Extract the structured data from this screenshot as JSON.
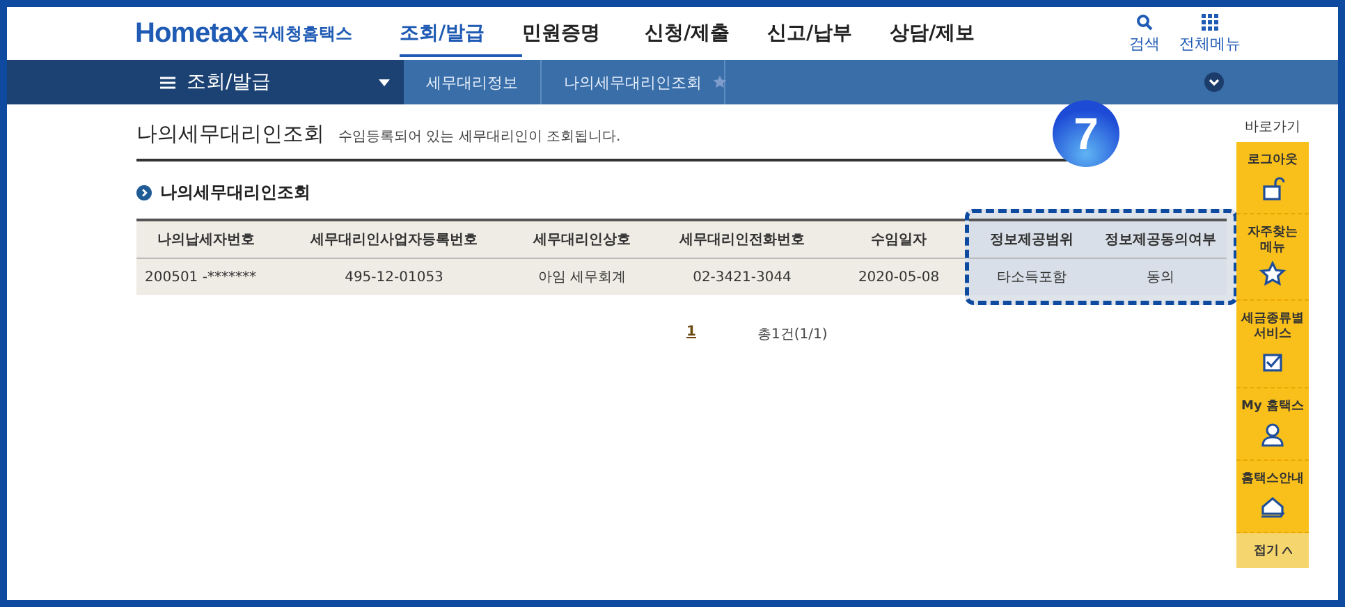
{
  "header": {
    "logo": {
      "brand": "Hometax",
      "name": "국세청홈택스"
    },
    "nav": [
      {
        "label": "조회/발급",
        "selected": true
      },
      {
        "label": "민원증명",
        "selected": false
      },
      {
        "label": "신청/제출",
        "selected": false
      },
      {
        "label": "신고/납부",
        "selected": false
      },
      {
        "label": "상담/제보",
        "selected": false
      }
    ],
    "utilities": [
      {
        "label": "검색",
        "kind": "search"
      },
      {
        "label": "전체메뉴",
        "kind": "menu"
      }
    ]
  },
  "navbar": {
    "menu_title": "조회/발급",
    "breadcrumbs": [
      "세무대리정보",
      "나의세무대리인조회"
    ]
  },
  "page": {
    "title": "나의세무대리인조회",
    "subtitle": "수임등록되어 있는 세무대리인이 조회됩니다.",
    "step_badge": "7",
    "section_title": "나의세무대리인조회",
    "table": {
      "columns": [
        {
          "label": "나의납세자번호",
          "highlighted": false
        },
        {
          "label": "세무대리인사업자등록번호",
          "highlighted": false
        },
        {
          "label": "세무대리인상호",
          "highlighted": false
        },
        {
          "label": "세무대리인전화번호",
          "highlighted": false
        },
        {
          "label": "수임일자",
          "highlighted": false
        },
        {
          "label": "정보제공범위",
          "highlighted": true
        },
        {
          "label": "정보제공동의여부",
          "highlighted": true
        }
      ],
      "rows": [
        [
          "200501 -*******",
          "495-12-01053",
          "아임 세무회계",
          "02-3421-3044",
          "2020-05-08",
          "타소득포함",
          "동의"
        ]
      ]
    },
    "pagination": {
      "pages": [
        {
          "label": "1",
          "selected": true
        }
      ],
      "summary": "총1건(1/1)"
    }
  },
  "quick_menu": {
    "title": "바로가기",
    "items": [
      {
        "label": "로그아웃",
        "kind": "lock"
      },
      {
        "label": "자주찾는 메뉴",
        "kind": "star"
      },
      {
        "label": "세금종류별 서비스",
        "kind": "check"
      },
      {
        "label": "My 홈택스",
        "kind": "person"
      },
      {
        "label": "홈택스안내",
        "kind": "house"
      }
    ],
    "collapse": "접기"
  }
}
